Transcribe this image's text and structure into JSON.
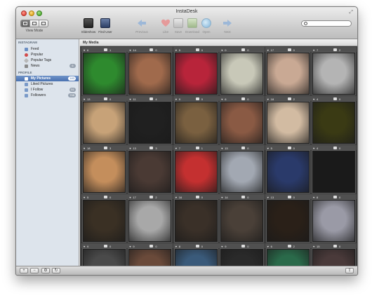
{
  "window": {
    "title": "InstaDesk"
  },
  "toolbar": {
    "view_mode_label": "View Mode",
    "buttons": [
      {
        "label": "Slideshow",
        "icon": "slideshow-icon",
        "enabled": true
      },
      {
        "label": "Find User",
        "icon": "find-user-icon",
        "enabled": true
      },
      {
        "label": "Previous",
        "icon": "previous-arrow-icon",
        "enabled": false
      },
      {
        "label": "Like",
        "icon": "heart-icon",
        "enabled": false
      },
      {
        "label": "Save",
        "icon": "save-icon",
        "enabled": false
      },
      {
        "label": "Download",
        "icon": "download-icon",
        "enabled": false
      },
      {
        "label": "Open",
        "icon": "open-icon",
        "enabled": false
      },
      {
        "label": "Next",
        "icon": "next-arrow-icon",
        "enabled": false
      }
    ],
    "search_placeholder": ""
  },
  "sidebar": {
    "instagram_header": "INSTAGRAM",
    "instagram_items": [
      {
        "label": "Feed",
        "icon": "feed-icon",
        "badge": ""
      },
      {
        "label": "Popular",
        "icon": "heart-icon",
        "badge": ""
      },
      {
        "label": "Popular Tags",
        "icon": "tag-icon",
        "badge": ""
      },
      {
        "label": "News",
        "icon": "news-icon",
        "badge": "6"
      }
    ],
    "profile_header": "PROFILE",
    "profile_items": [
      {
        "label": "My Pictures",
        "icon": "pictures-icon",
        "badge": "183",
        "selected": true
      },
      {
        "label": "Liked Pictures",
        "icon": "liked-icon",
        "badge": ""
      },
      {
        "label": "I Follow",
        "icon": "follow-icon",
        "badge": "51"
      },
      {
        "label": "Followers",
        "icon": "followers-icon",
        "badge": "746"
      }
    ]
  },
  "main": {
    "title": "My Media",
    "photos": [
      {
        "likes": "6",
        "comments": "1",
        "color": "#2e8a2e"
      },
      {
        "likes": "14",
        "comments": "0",
        "color": "#a06a4c"
      },
      {
        "likes": "5",
        "comments": "0",
        "color": "#b8243a"
      },
      {
        "likes": "0",
        "comments": "0",
        "color": "#c8c8b8"
      },
      {
        "likes": "17",
        "comments": "0",
        "color": "#c9a994"
      },
      {
        "likes": "7",
        "comments": "2",
        "color": "#b4b4b4"
      },
      {
        "likes": "13",
        "comments": "0",
        "color": "#c7a278"
      },
      {
        "likes": "11",
        "comments": "4",
        "color": "#202020"
      },
      {
        "likes": "9",
        "comments": "0",
        "color": "#7a6040"
      },
      {
        "likes": "6",
        "comments": "0",
        "color": "#8a5a44"
      },
      {
        "likes": "18",
        "comments": "2",
        "color": "#d2bba2"
      },
      {
        "likes": "4",
        "comments": "0",
        "color": "#3a3a14"
      },
      {
        "likes": "18",
        "comments": "3",
        "color": "#c48e5c"
      },
      {
        "likes": "13",
        "comments": "3",
        "color": "#4a3a34"
      },
      {
        "likes": "7",
        "comments": "1",
        "color": "#c43030"
      },
      {
        "likes": "13",
        "comments": "0",
        "color": "#a2a8b2"
      },
      {
        "likes": "5",
        "comments": "0",
        "color": "#2a3a6a"
      },
      {
        "likes": "4",
        "comments": "0",
        "color": "#1a1a1a"
      },
      {
        "likes": "5",
        "comments": "0",
        "color": "#3a3024"
      },
      {
        "likes": "17",
        "comments": "2",
        "color": "#a8a8a8"
      },
      {
        "likes": "16",
        "comments": "0",
        "color": "#3a3028"
      },
      {
        "likes": "14",
        "comments": "0",
        "color": "#4a4038"
      },
      {
        "likes": "13",
        "comments": "0",
        "color": "#2a2018"
      },
      {
        "likes": "8",
        "comments": "0",
        "color": "#9a9aa6"
      },
      {
        "likes": "9",
        "comments": "0",
        "color": "#4a4a4a"
      },
      {
        "likes": "9",
        "comments": "0",
        "color": "#6a4a3a"
      },
      {
        "likes": "8",
        "comments": "0",
        "color": "#3a5a7a"
      },
      {
        "likes": "9",
        "comments": "0",
        "color": "#2a2a2a"
      },
      {
        "likes": "6",
        "comments": "2",
        "color": "#2a6a4a"
      },
      {
        "likes": "15",
        "comments": "0",
        "color": "#4a3a3a"
      }
    ]
  },
  "colors": {
    "sidebar_bg": "#dde4ec",
    "selection": "#4a72b0",
    "grid_bg": "#3a3a3a"
  }
}
